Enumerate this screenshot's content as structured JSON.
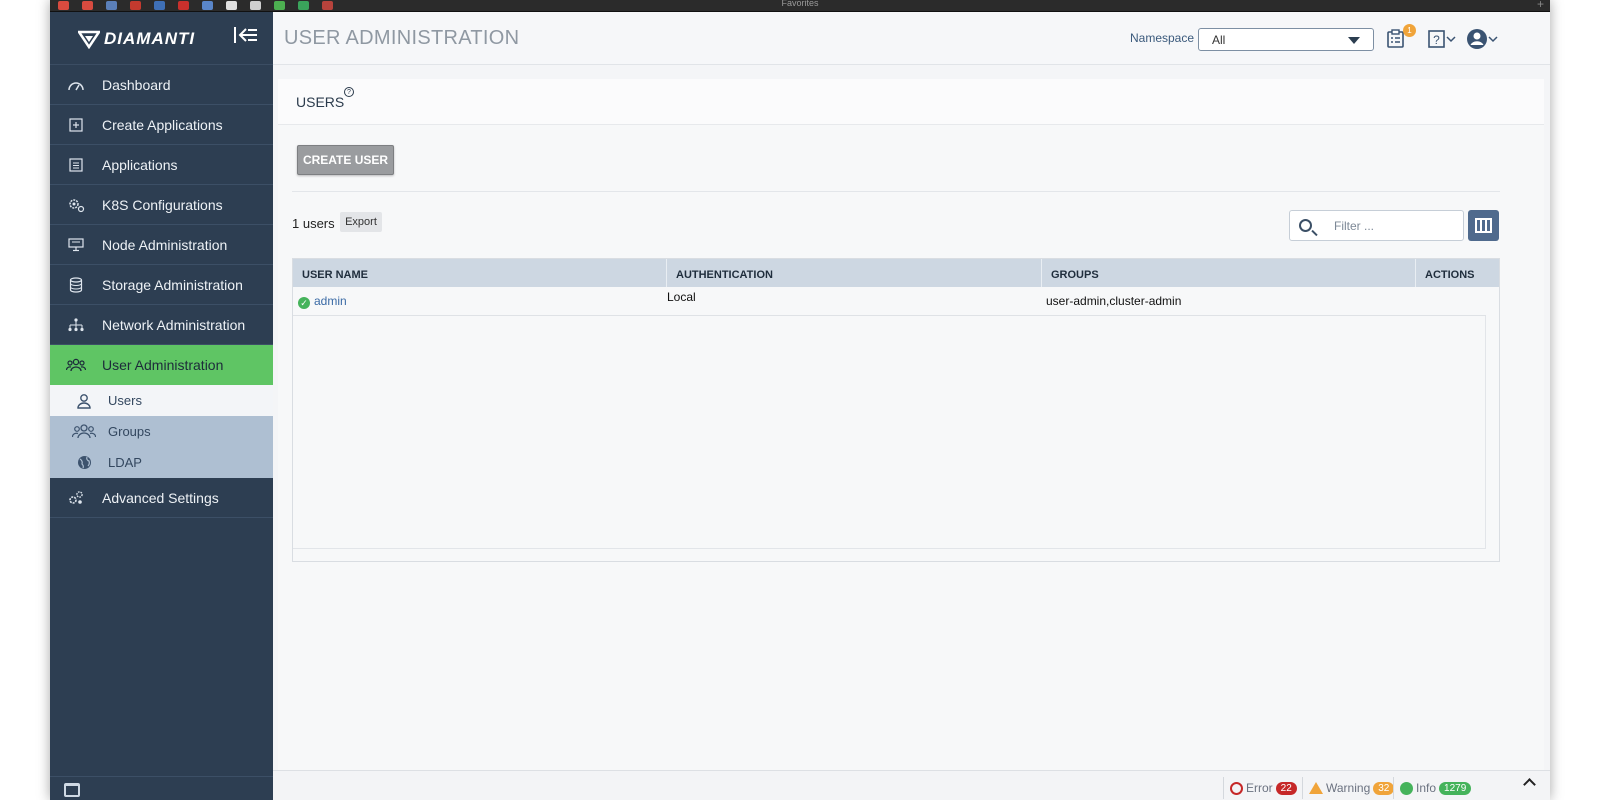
{
  "favorites_bar": {
    "title": "Favorites",
    "add_label": "+",
    "icon_colors": [
      "#d84b3f",
      "#d84b3f",
      "#5b7fb8",
      "#c43a2e",
      "#3f6fb5",
      "#c9302c",
      "#5a86c9",
      "#e0e0e0",
      "#cfcfcf",
      "#4caf50",
      "#3aa35b",
      "#b7433c"
    ]
  },
  "brand": {
    "name": "DIAMANTI",
    "collapse_icon": "collapse-menu-icon"
  },
  "sidebar": {
    "items": [
      {
        "label": "Dashboard",
        "icon": "gauge-icon"
      },
      {
        "label": "Create Applications",
        "icon": "plus-square-icon"
      },
      {
        "label": "Applications",
        "icon": "list-icon"
      },
      {
        "label": "K8S Configurations",
        "icon": "gears-icon"
      },
      {
        "label": "Node Administration",
        "icon": "monitor-icon"
      },
      {
        "label": "Storage Administration",
        "icon": "database-icon"
      },
      {
        "label": "Network Administration",
        "icon": "network-icon"
      },
      {
        "label": "User Administration",
        "icon": "users-icon",
        "active": true
      },
      {
        "label": "Advanced Settings",
        "icon": "advanced-settings-icon"
      }
    ],
    "subitems": [
      {
        "label": "Users",
        "icon": "user-icon",
        "active": true
      },
      {
        "label": "Groups",
        "icon": "group-icon"
      },
      {
        "label": "LDAP",
        "icon": "globe-icon"
      }
    ],
    "active_color": "#5fc564",
    "background_color": "#2d3e52"
  },
  "topbar": {
    "title": "USER ADMINISTRATION",
    "namespace_label": "Namespace",
    "namespace_value": "All",
    "notifications_count": "1"
  },
  "users_panel": {
    "title": "USERS",
    "help_mark": "?",
    "create_button": "CREATE USER",
    "count_text": "1 users",
    "export_button": "Export",
    "filter_placeholder": "Filter ..."
  },
  "table": {
    "columns": [
      "USER NAME",
      "AUTHENTICATION",
      "GROUPS",
      "ACTIONS"
    ],
    "rows": [
      {
        "status": "active",
        "user_name": "admin",
        "authentication": "Local",
        "groups": "user-admin,cluster-admin",
        "actions": ""
      }
    ]
  },
  "statusbar": {
    "error_label": "Error",
    "error_count": "22",
    "warning_label": "Warning",
    "warning_count": "32",
    "info_label": "Info",
    "info_count": "1279",
    "error_color": "#c62828",
    "warning_color": "#f0a43a",
    "info_color": "#45b35b"
  }
}
